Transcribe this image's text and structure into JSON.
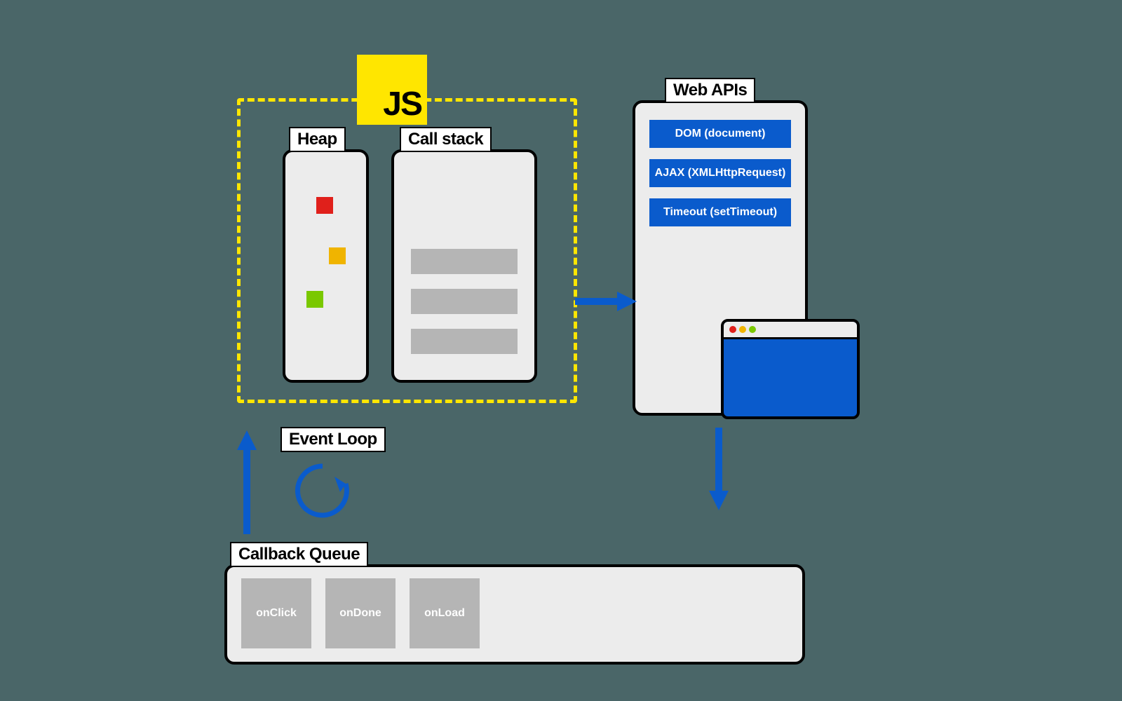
{
  "js_badge": "JS",
  "heap_label": "Heap",
  "callstack_label": "Call stack",
  "webapis_label": "Web APIs",
  "eventloop_label": "Event Loop",
  "callbackqueue_label": "Callback Queue",
  "web_apis": [
    "DOM (document)",
    "AJAX (XMLHttpRequest)",
    "Timeout (setTimeout)"
  ],
  "callbacks": [
    "onClick",
    "onDone",
    "onLoad"
  ],
  "heap_dots": [
    {
      "color": "#e0201b"
    },
    {
      "color": "#f0b400"
    },
    {
      "color": "#7ac800"
    }
  ],
  "colors": {
    "accent": "#0a5bcc",
    "js_yellow": "#ffe600",
    "panel": "#ececec",
    "slot": "#b5b5b5",
    "bg": "#4a6668"
  }
}
